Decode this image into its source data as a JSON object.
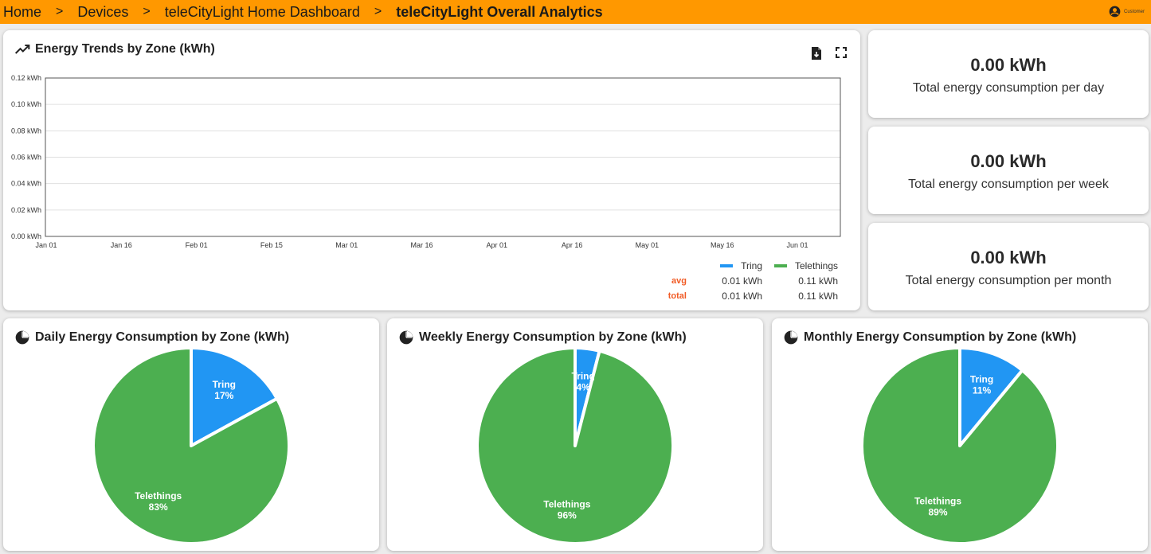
{
  "breadcrumb": {
    "items": [
      "Home",
      "Devices",
      "teleCityLight Home Dashboard",
      "teleCityLight Overall Analytics"
    ],
    "separator": ">"
  },
  "user": {
    "label": "Customer"
  },
  "trend": {
    "title": "Energy Trends by Zone (kWh)",
    "legend": {
      "series": [
        "Tring",
        "Telethings"
      ],
      "rows": [
        {
          "key": "avg",
          "values": [
            "0.01 kWh",
            "0.11 kWh"
          ]
        },
        {
          "key": "total",
          "values": [
            "0.01 kWh",
            "0.11 kWh"
          ]
        }
      ]
    }
  },
  "stats": [
    {
      "value": "0.00 kWh",
      "label": "Total energy consumption per day"
    },
    {
      "value": "0.00 kWh",
      "label": "Total energy consumption per week"
    },
    {
      "value": "0.00 kWh",
      "label": "Total energy consumption per month"
    }
  ],
  "pies": {
    "daily_title": "Daily Energy Consumption by Zone (kWh)",
    "weekly_title": "Weekly Energy Consumption by Zone (kWh)",
    "monthly_title": "Monthly Energy Consumption by Zone (kWh)"
  },
  "colors": {
    "tring": "#2196f3",
    "telethings": "#4caf50",
    "accent": "#ff9800"
  },
  "chart_data": [
    {
      "type": "line",
      "title": "Energy Trends by Zone (kWh)",
      "x": [
        "Jan 01",
        "Jan 16",
        "Feb 01",
        "Feb 15",
        "Mar 01",
        "Mar 16",
        "Apr 01",
        "Apr 16",
        "May 01",
        "May 16",
        "Jun 01"
      ],
      "yticks": [
        "0.00 kWh",
        "0.02 kWh",
        "0.04 kWh",
        "0.06 kWh",
        "0.08 kWh",
        "0.10 kWh",
        "0.12 kWh"
      ],
      "ylim": [
        0,
        0.12
      ],
      "grid": true,
      "legend": "bottom-right",
      "series": [
        {
          "name": "Tring",
          "values": []
        },
        {
          "name": "Telethings",
          "values": []
        }
      ]
    },
    {
      "type": "pie",
      "title": "Daily Energy Consumption by Zone (kWh)",
      "slices": [
        {
          "name": "Tring",
          "percent": 17,
          "label": "17%"
        },
        {
          "name": "Telethings",
          "percent": 83,
          "label": "83%"
        }
      ]
    },
    {
      "type": "pie",
      "title": "Weekly Energy Consumption by Zone (kWh)",
      "slices": [
        {
          "name": "Tring",
          "percent": 4,
          "label": "4%"
        },
        {
          "name": "Telethings",
          "percent": 96,
          "label": "96%"
        }
      ]
    },
    {
      "type": "pie",
      "title": "Monthly Energy Consumption by Zone (kWh)",
      "slices": [
        {
          "name": "Tring",
          "percent": 11,
          "label": "11%"
        },
        {
          "name": "Telethings",
          "percent": 89,
          "label": "89%"
        }
      ]
    }
  ]
}
